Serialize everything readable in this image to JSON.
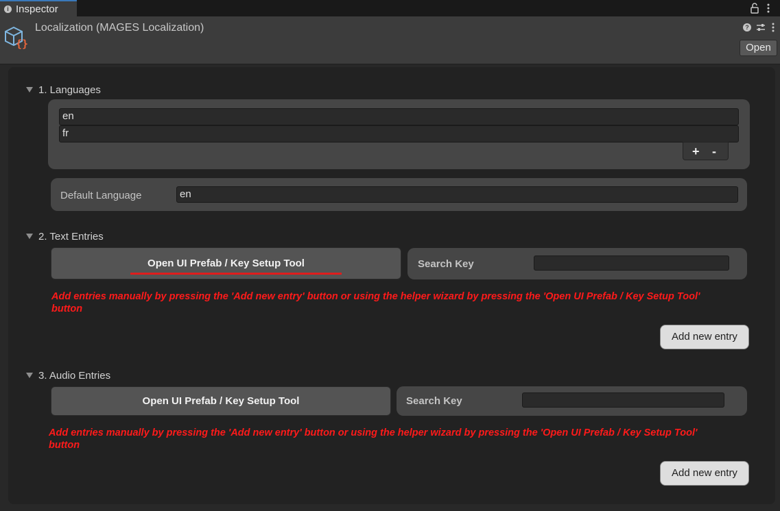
{
  "window": {
    "tab_label": "Inspector",
    "tab_icon": "info-icon",
    "right_icons": [
      "lock-icon",
      "kebab-menu-icon"
    ]
  },
  "header": {
    "component_icon": "scriptable-object-icon",
    "title": "Localization (MAGES Localization)",
    "icons": [
      "help-icon",
      "presets-icon",
      "kebab-menu-icon"
    ],
    "open_label": "Open"
  },
  "sections": {
    "languages": {
      "label": "1. Languages",
      "items": [
        "en",
        "fr"
      ],
      "add_label": "+",
      "remove_label": "-",
      "default_language_label": "Default Language",
      "default_language_value": "en"
    },
    "text_entries": {
      "label": "2. Text Entries",
      "tool_button_label": "Open UI Prefab / Key Setup Tool",
      "search_label": "Search Key",
      "search_value": "",
      "warning_line1": "Add entries manually by pressing the 'Add new entry' button or using the helper wizard by pressing the 'Open UI Prefab / Key Setup Tool'",
      "warning_line2": "button",
      "add_entry_label": "Add new entry"
    },
    "audio_entries": {
      "label": "3. Audio Entries",
      "tool_button_label": "Open UI Prefab / Key Setup Tool",
      "search_label": "Search Key",
      "search_value": "",
      "warning_line1": "Add entries manually by pressing the 'Add new entry' button or using the helper wizard by pressing the 'Open UI Prefab / Key Setup Tool'",
      "warning_line2": "button",
      "add_entry_label": "Add new entry"
    }
  },
  "colors": {
    "background": "#282828",
    "panel": "#222222",
    "warning": "#ff1a1a",
    "annotation_underline": "#e01d1d",
    "tab_accent": "#3a79bb"
  }
}
